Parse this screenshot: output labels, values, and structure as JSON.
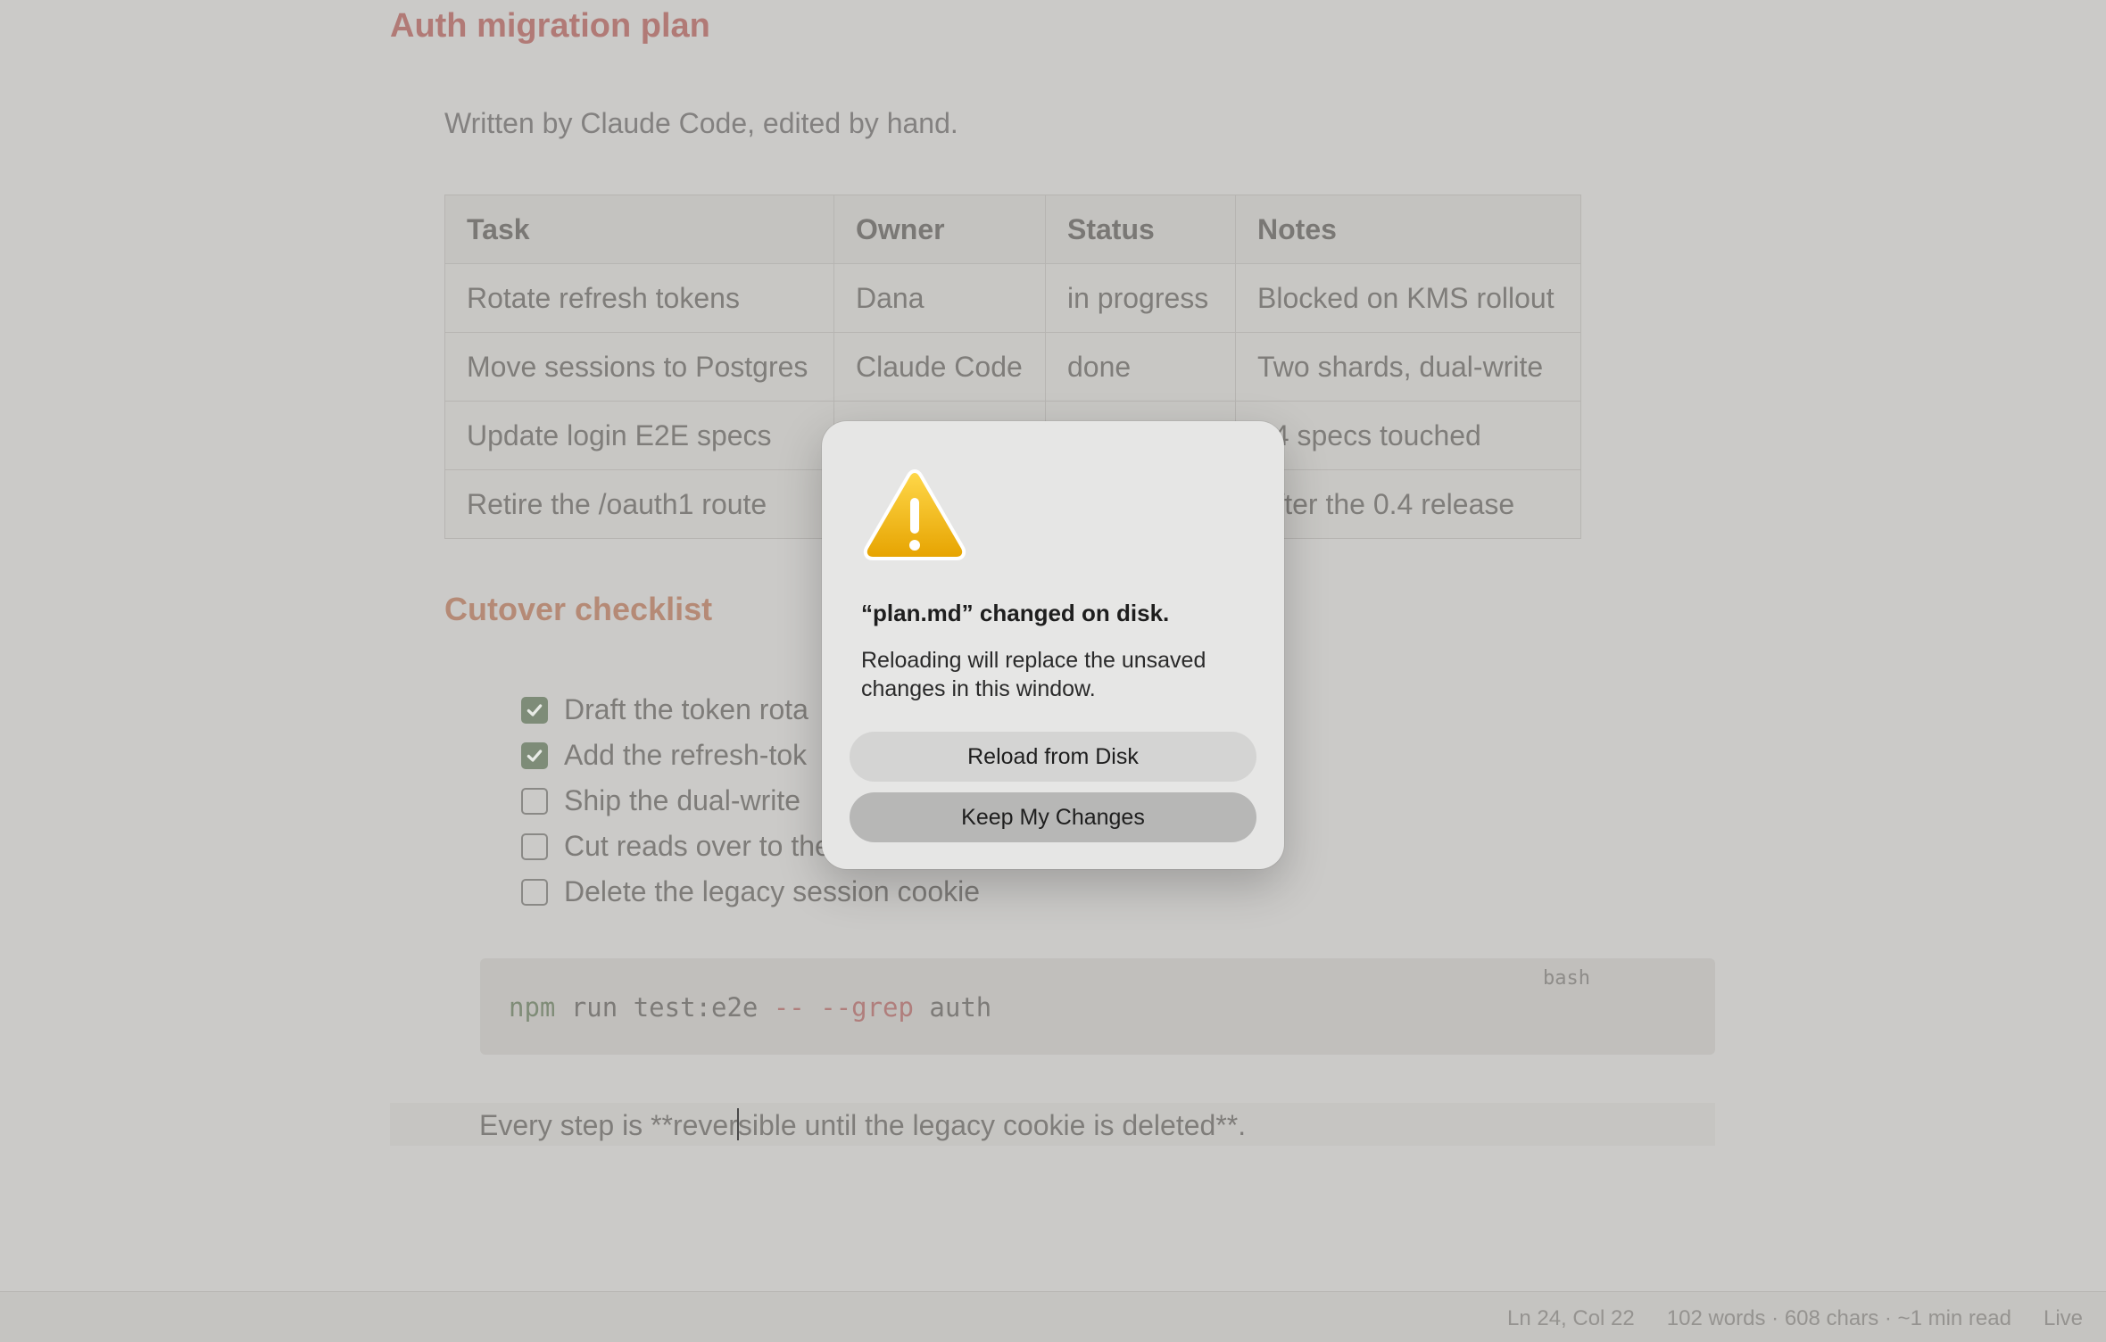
{
  "document": {
    "heading": "Auth migration plan",
    "subtitle": "Written by Claude Code, edited by hand.",
    "table": {
      "headers": [
        "Task",
        "Owner",
        "Status",
        "Notes"
      ],
      "rows": [
        [
          "Rotate refresh tokens",
          "Dana",
          "in progress",
          "Blocked on KMS rollout"
        ],
        [
          "Move sessions to Postgres",
          "Claude Code",
          "done",
          "Two shards, dual-write"
        ],
        [
          "Update login E2E specs",
          "",
          "",
          "14 specs touched"
        ],
        [
          "Retire the /oauth1 route",
          "",
          "",
          "After the 0.4 release"
        ]
      ]
    },
    "checklist_heading": "Cutover checklist",
    "checklist": [
      {
        "label": "Draft the token rota",
        "checked": true
      },
      {
        "label": "Add the refresh-tok",
        "checked": true
      },
      {
        "label": "Ship the dual-write",
        "checked": false
      },
      {
        "label": "Cut reads over to the",
        "checked": false
      },
      {
        "label": "Delete the legacy session cookie",
        "checked": false
      }
    ],
    "code_block": {
      "language": "bash",
      "cmd": "npm",
      "mid": " run test:e2e ",
      "flags": "-- --grep",
      "tail": " auth"
    },
    "paragraph": {
      "before_caret": "Every step is **rever",
      "after_caret": "sible until the legacy cookie is deleted**."
    }
  },
  "status_bar": {
    "position": "Ln 24, Col 22",
    "stats": "102 words · 608 chars · ~1 min read",
    "mode": "Live"
  },
  "dialog": {
    "icon": "warning-icon",
    "title": "“plan.md” changed on disk.",
    "message": "Reloading will replace the unsaved changes in this window.",
    "reload_label": "Reload from Disk",
    "keep_label": "Keep My Changes"
  },
  "colors": {
    "heading": "#b17a76",
    "checkbox_checked": "#7e8c78",
    "warning_yellow": "#f2b705"
  }
}
